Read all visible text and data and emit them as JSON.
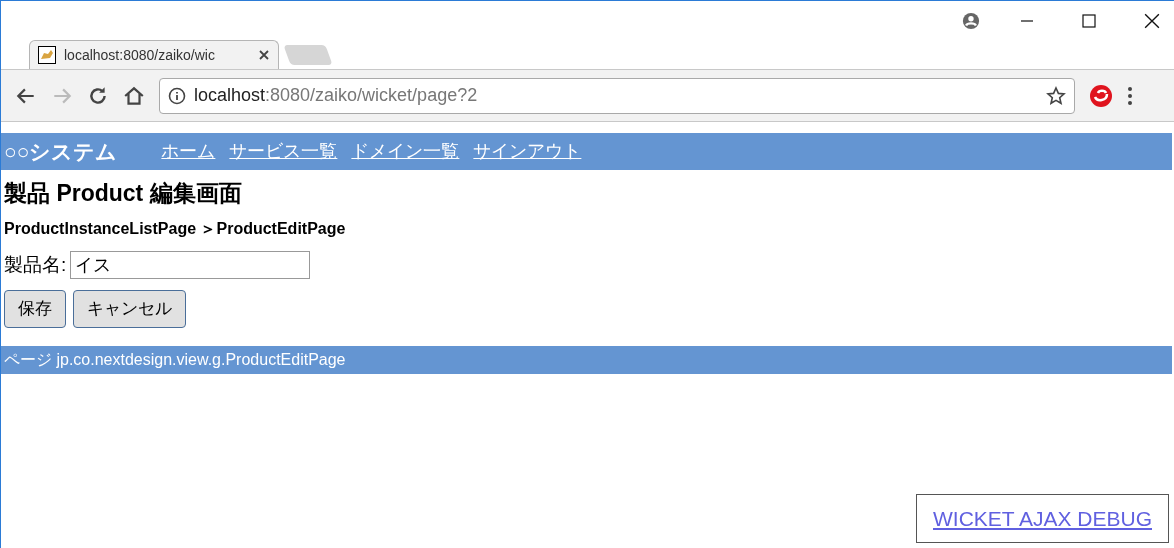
{
  "browser": {
    "tabs": [
      {
        "title": "localhost:8080/zaiko/wic",
        "selected": true
      }
    ],
    "address": {
      "host": "localhost",
      "rest": ":8080/zaiko/wicket/page?2"
    }
  },
  "header": {
    "brand": "○○システム",
    "links": [
      "ホーム",
      "サービス一覧",
      "ドメイン一覧",
      "サインアウト"
    ]
  },
  "page": {
    "title": "製品 Product 編集画面",
    "breadcrumb": "ProductInstanceListPage ＞ProductEditPage",
    "field": {
      "label": "製品名:",
      "value": "イス"
    },
    "buttons": [
      "保存",
      "キャンセル"
    ],
    "footer": "ページ jp.co.nextdesign.view.g.ProductEditPage",
    "debug_link": "WICKET AJAX DEBUG"
  }
}
